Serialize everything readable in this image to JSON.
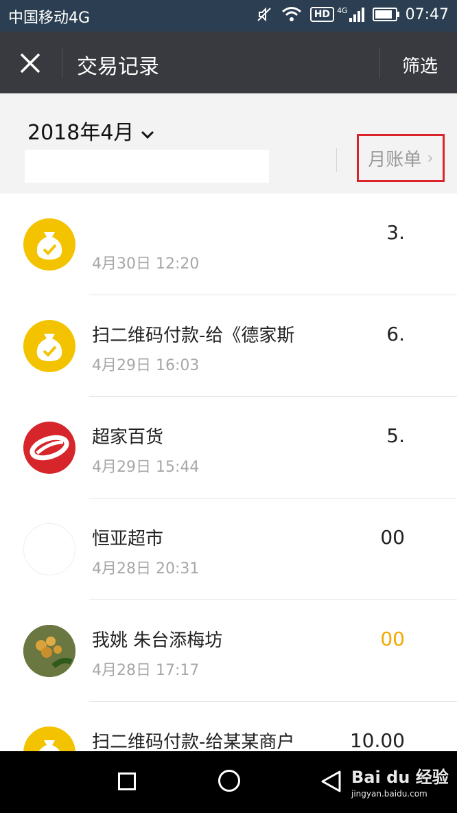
{
  "status_bar": {
    "carrier": "中国移动4G",
    "hd_label": "HD",
    "network_label": "4G",
    "time": "07:47",
    "battery_level": 0.85
  },
  "top_bar": {
    "close_icon": "close-icon",
    "title": "交易记录",
    "filter_label": "筛选"
  },
  "summary": {
    "month_label": "2018年4月",
    "month_chevron": "⌄",
    "monthly_bill_label": "月账单",
    "monthly_bill_arrow": "›"
  },
  "transactions": [
    {
      "avatar": "money-bag-icon",
      "name": "",
      "time": "4月30日 12:20",
      "amount": "3."
    },
    {
      "avatar": "money-bag-icon",
      "name": "扫二维码付款-给《德家斯",
      "time": "4月29日 16:03",
      "amount": "6."
    },
    {
      "avatar": "red-logo",
      "name": "超家百货",
      "time": "4月29日 15:44",
      "amount": "5."
    },
    {
      "avatar": "blank-avatar",
      "name": "恒亚超市",
      "time": "4月28日 20:31",
      "amount": "00"
    },
    {
      "avatar": "fruit-photo",
      "name": "我姚 朱台添梅坊",
      "time": "4月28日 17:17",
      "amount": "00"
    },
    {
      "avatar": "money-bag-icon",
      "name": "扫二维码付款-给某某商户",
      "time": "",
      "amount": "10.00"
    }
  ],
  "nav_bar": {
    "square_icon": "recent-apps-icon",
    "circle_icon": "home-icon",
    "back_icon": "back-icon"
  },
  "watermark": {
    "brand": "Bai du 经验",
    "url": "jingyan.baidu.com"
  },
  "colors": {
    "status_bar_bg": "#2c3f52",
    "top_bar_bg": "#393a3f",
    "highlight_border": "#d9242b",
    "money_icon_bg": "#f3c300",
    "orange_amount": "#f2a800"
  }
}
